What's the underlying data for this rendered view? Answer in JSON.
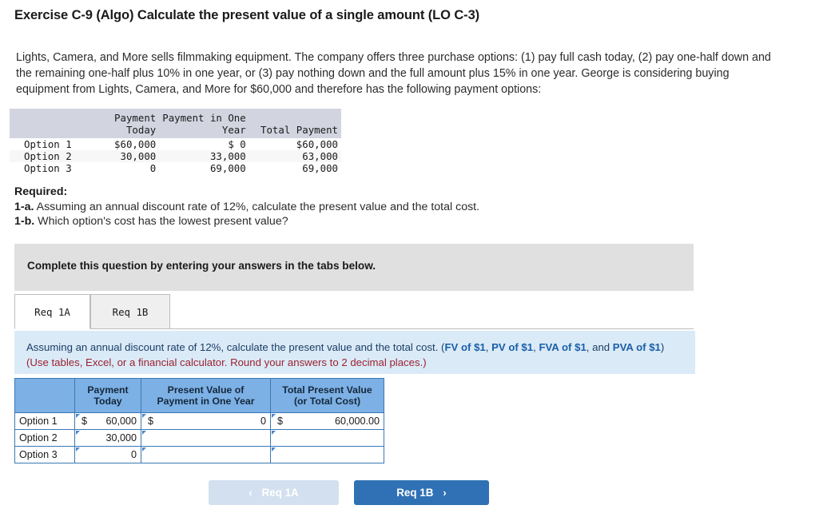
{
  "exercise": {
    "title": "Exercise C-9 (Algo) Calculate the present value of a single amount (LO C-3)",
    "intro": "Lights, Camera, and More sells filmmaking equipment. The company offers three purchase options: (1) pay full cash today, (2) pay one-half down and the remaining one-half plus 10% in one year, or (3) pay nothing down and the full amount plus 15% in one year. George is considering buying equipment from Lights, Camera, and More for $60,000 and therefore has the following payment options:"
  },
  "data_table": {
    "headers": {
      "blank": "",
      "payment_today_line1": "Payment",
      "payment_today_line2": "Today",
      "payment_one_year_line1": "Payment in One",
      "payment_one_year_line2": "Year",
      "total_payment_line1": "",
      "total_payment_line2": "Total Payment"
    },
    "rows": [
      {
        "option": "Option 1",
        "payment_today": "$60,000",
        "payment_one_year": "$ 0",
        "total_payment": "$60,000"
      },
      {
        "option": "Option 2",
        "payment_today": "30,000",
        "payment_one_year": "33,000",
        "total_payment": "63,000"
      },
      {
        "option": "Option 3",
        "payment_today": "0",
        "payment_one_year": "69,000",
        "total_payment": "69,000"
      }
    ]
  },
  "required": {
    "heading": "Required:",
    "item_1a_tag": "1-a.",
    "item_1a_text": " Assuming an annual discount rate of 12%, calculate the present value and the total cost.",
    "item_1b_tag": "1-b.",
    "item_1b_text": " Which option's cost has the lowest present value?"
  },
  "gray_banner": {
    "text": "Complete this question by entering your answers in the tabs below."
  },
  "tabs": [
    {
      "label": "Req 1A",
      "active": true
    },
    {
      "label": "Req 1B",
      "active": false
    }
  ],
  "blue_panel": {
    "line1_lead": "Assuming an annual discount rate of 12%, calculate the present value and the total cost. (",
    "link_fv": "FV of $1",
    "sep1": ", ",
    "link_pv": "PV of $1",
    "sep2": ", ",
    "link_fva": "FVA of $1",
    "sep3": ", and ",
    "link_pva": "PVA of $1",
    "after_links": ") ",
    "note": "(Use tables, Excel, or a financial calculator. Round your answers to 2 decimal places.)"
  },
  "answer_table": {
    "headers": {
      "corner": "",
      "payment_today": "Payment\nToday",
      "payment_today_line1": "Payment",
      "payment_today_line2": "Today",
      "pv_one_year_line1": "Present Value of",
      "pv_one_year_line2": "Payment in One Year",
      "total_pv_line1": "Total Present Value",
      "total_pv_line2": "(or Total Cost)"
    },
    "rows": [
      {
        "label": "Option 1",
        "payment_today_symbol": "$",
        "payment_today_value": "60,000",
        "pv_one_year_symbol": "$",
        "pv_one_year_value": "0",
        "total_pv_symbol": "$",
        "total_pv_value": "60,000.00"
      },
      {
        "label": "Option 2",
        "payment_today_symbol": "",
        "payment_today_value": "30,000",
        "pv_one_year_symbol": "",
        "pv_one_year_value": "",
        "total_pv_symbol": "",
        "total_pv_value": ""
      },
      {
        "label": "Option 3",
        "payment_today_symbol": "",
        "payment_today_value": "0",
        "pv_one_year_symbol": "",
        "pv_one_year_value": "",
        "total_pv_symbol": "",
        "total_pv_value": ""
      }
    ]
  },
  "navigation": {
    "prev_label": "Req 1A",
    "prev_chevron": "‹",
    "next_label": "Req 1B",
    "next_chevron": "›"
  },
  "colors": {
    "header_blue": "#7db0e4",
    "panel_blue": "#daeaf7",
    "banner_gray": "#e0e0e0",
    "primary_button": "#2f71b4",
    "disabled_button": "#d3e0ef",
    "link_blue": "#1a5fa8",
    "note_red": "#9c2230"
  }
}
